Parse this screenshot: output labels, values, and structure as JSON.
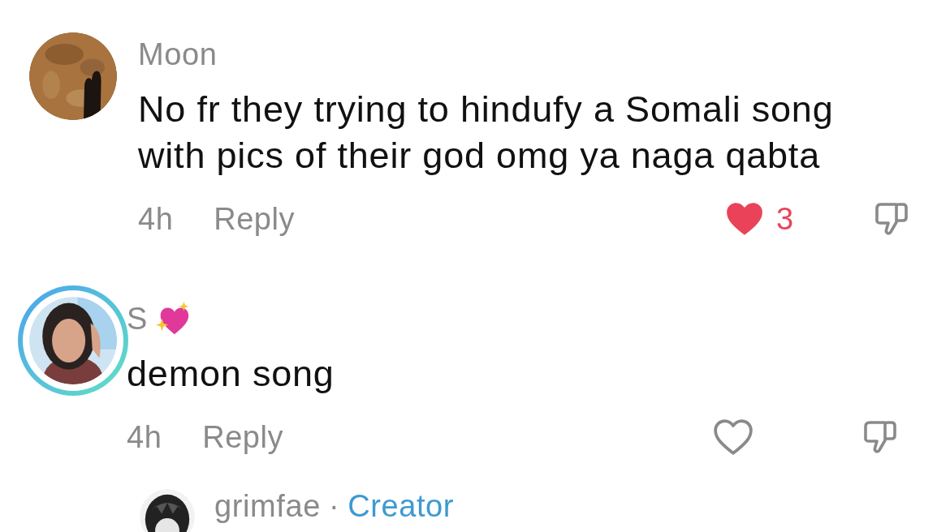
{
  "comments": [
    {
      "author": "Moon",
      "name_emoji": false,
      "story_ring": false,
      "text": "No fr they trying to hindufy a Somali song with pics of their god omg ya naga qabta",
      "time": "4h",
      "reply": "Reply",
      "liked": true,
      "likes": "3"
    },
    {
      "author": "S",
      "name_emoji": true,
      "story_ring": true,
      "text": "demon song",
      "time": "4h",
      "reply": "Reply",
      "liked": false
    }
  ],
  "partial_reply": {
    "author": "grimfae",
    "separator": "·",
    "role": "Creator"
  }
}
